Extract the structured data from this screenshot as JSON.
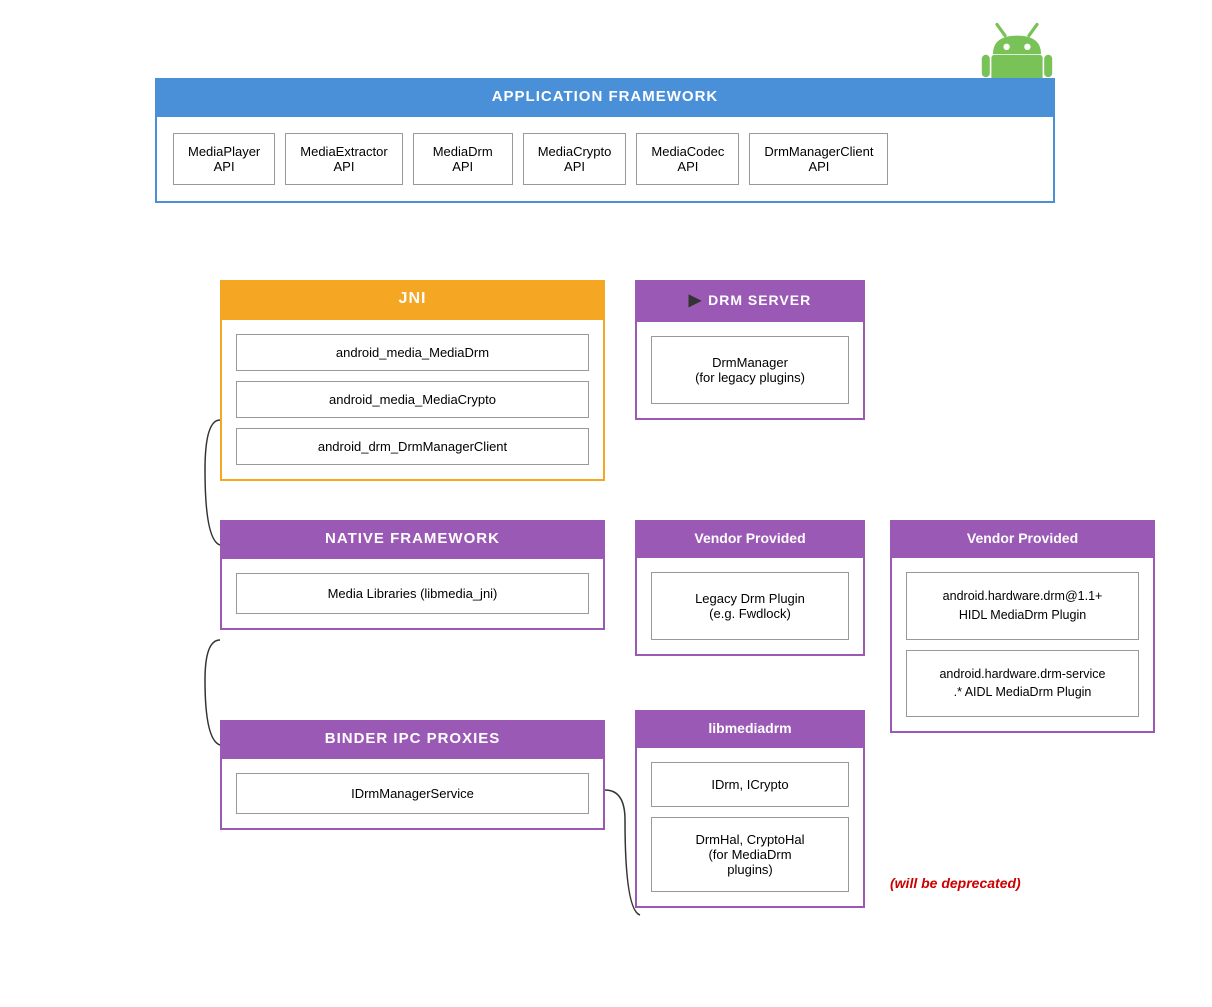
{
  "android_logo": {
    "alt": "Android Logo",
    "color_body": "#78C257",
    "color_head": "#78C257"
  },
  "app_framework": {
    "header": "APPLICATION FRAMEWORK",
    "apis": [
      {
        "line1": "MediaPlayer",
        "line2": "API"
      },
      {
        "line1": "MediaExtractor",
        "line2": "API"
      },
      {
        "line1": "MediaDrm",
        "line2": "API"
      },
      {
        "line1": "MediaCrypto",
        "line2": "API"
      },
      {
        "line1": "MediaCodec",
        "line2": "API"
      },
      {
        "line1": "DrmManagerClient",
        "line2": "API"
      }
    ]
  },
  "jni": {
    "header": "JNI",
    "items": [
      "android_media_MediaDrm",
      "android_media_MediaCrypto",
      "android_drm_DrmManagerClient"
    ]
  },
  "drm_server": {
    "header": "DRM SERVER",
    "item": "DrmManager\n(for legacy plugins)"
  },
  "native_framework": {
    "header": "NATIVE FRAMEWORK",
    "item": "Media Libraries (libmedia_jni)"
  },
  "vendor_left": {
    "header": "Vendor Provided",
    "item": "Legacy Drm Plugin\n(e.g. Fwdlock)"
  },
  "vendor_right": {
    "header": "Vendor Provided",
    "items": [
      "android.hardware.drm@1.1+\nHIDL MediaDrm Plugin",
      "android.hardware.drm-service\n.* AIDL MediaDrm Plugin"
    ]
  },
  "binder": {
    "header": "BINDER IPC PROXIES",
    "item": "IDrmManagerService"
  },
  "libmediadrm": {
    "header": "libmediadrm",
    "items": [
      "IDrm, ICrypto",
      "DrmHal, CryptoHal\n(for MediaDrm\nplugins)"
    ]
  },
  "deprecated": "(will be deprecated)"
}
